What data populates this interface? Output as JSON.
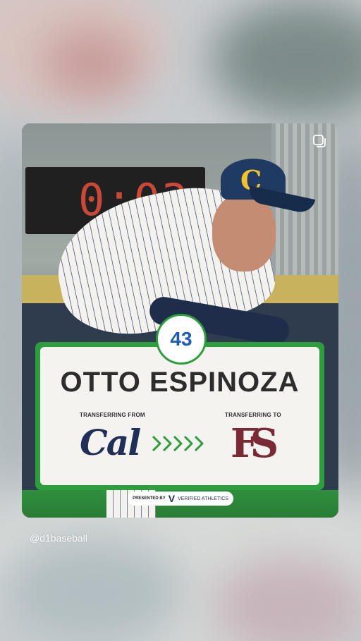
{
  "post": {
    "scoreboard_text": "0:03",
    "cap_letter": "C",
    "player_number": "43",
    "player_name": "OTTO ESPINOZA",
    "from_label": "TRANSFERRING FROM",
    "to_label": "TRANSFERRING TO",
    "from_school_logo_text": "Cal",
    "to_school_logo_text": "FS",
    "presented_by": "PRESENTED BY",
    "sponsor_mark": "V",
    "sponsor_name": "VERIFIED ATHLETICS"
  },
  "author": {
    "handle": "@d1baseball"
  },
  "icons": {
    "multi_post": "multiple-posts-icon",
    "arrows": "chevron-arrows-icon"
  },
  "colors": {
    "accent_green": "#2e9d3d",
    "number_blue": "#1f5db0",
    "cal_navy": "#1f2f58",
    "fsu_garnet": "#7a2a35"
  }
}
